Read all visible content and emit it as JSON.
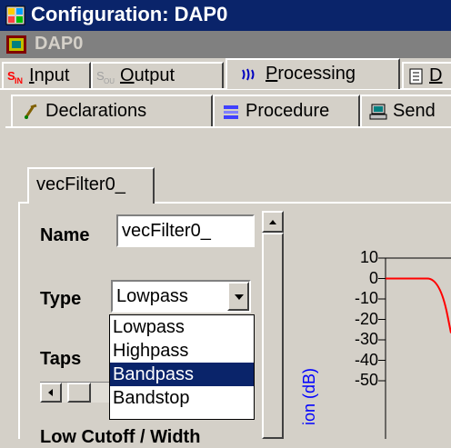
{
  "window": {
    "title": "Configuration: DAP0",
    "subtitle": "DAP0"
  },
  "tabs": [
    {
      "label": "Input",
      "accel": "I"
    },
    {
      "label": "Output",
      "accel": "O"
    },
    {
      "label": "Processing",
      "accel": "P"
    },
    {
      "label": "D"
    }
  ],
  "subtabs": [
    {
      "label": "Declarations"
    },
    {
      "label": "Procedure"
    },
    {
      "label": "Send"
    }
  ],
  "filter_tab": {
    "label": "vecFilter0_"
  },
  "form": {
    "name_label": "Name",
    "name_value": "vecFilter0_",
    "type_label": "Type",
    "type_value": "Lowpass",
    "taps_label": "Taps",
    "cutoff_label": "Low Cutoff / Width"
  },
  "type_options": [
    "Lowpass",
    "Highpass",
    "Bandpass",
    "Bandstop"
  ],
  "type_highlighted": "Bandpass",
  "chart": {
    "ylabel": "ion (dB)",
    "yticks": [
      "10",
      "0",
      "-10",
      "-20",
      "-30",
      "-40",
      "-50"
    ],
    "line_color": "#ff0000"
  }
}
